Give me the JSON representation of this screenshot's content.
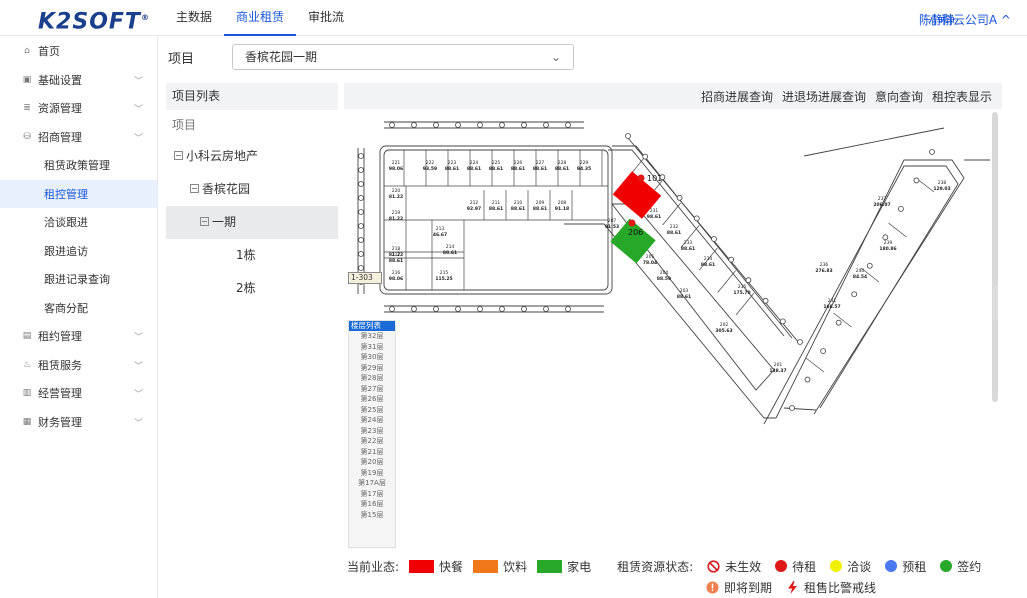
{
  "app": {
    "logo": "K2SOFT",
    "logo_mark": "®"
  },
  "topnav": [
    {
      "label": "主数据",
      "active": false
    },
    {
      "label": "商业租赁",
      "active": true
    },
    {
      "label": "审批流",
      "active": false
    }
  ],
  "header": {
    "user": "陈静静",
    "company": "小科云公司A ^"
  },
  "sidebar": {
    "items": [
      {
        "label": "首页",
        "icon": "home-icon",
        "glyph": "⌂",
        "expandable": false
      },
      {
        "label": "基础设置",
        "icon": "settings-icon",
        "glyph": "▣",
        "expandable": true
      },
      {
        "label": "资源管理",
        "icon": "resource-icon",
        "glyph": "≣",
        "expandable": true
      },
      {
        "label": "招商管理",
        "icon": "merchant-icon",
        "glyph": "⛁",
        "expandable": true
      }
    ],
    "subitems": [
      {
        "label": "租赁政策管理",
        "active": false
      },
      {
        "label": "租控管理",
        "active": true
      },
      {
        "label": "洽谈跟进",
        "active": false
      },
      {
        "label": "跟进追访",
        "active": false
      },
      {
        "label": "跟进记录查询",
        "active": false
      },
      {
        "label": "客商分配",
        "active": false
      }
    ],
    "items2": [
      {
        "label": "租约管理",
        "icon": "contract-icon",
        "glyph": "▤"
      },
      {
        "label": "租赁服务",
        "icon": "service-icon",
        "glyph": "♨"
      },
      {
        "label": "经营管理",
        "icon": "operation-icon",
        "glyph": "▥"
      },
      {
        "label": "财务管理",
        "icon": "finance-icon",
        "glyph": "▦"
      }
    ]
  },
  "project": {
    "label": "项目",
    "selected": "香槟花园一期"
  },
  "tree": {
    "title": "项目列表",
    "subtitle": "项目",
    "nodes": [
      {
        "label": "小科云房地产",
        "level": 0,
        "box": true,
        "selected": false
      },
      {
        "label": "香槟花园",
        "level": 1,
        "box": true,
        "selected": false
      },
      {
        "label": "一期",
        "level": 2,
        "box": true,
        "selected": true
      },
      {
        "label": "1栋",
        "level": 3,
        "box": false,
        "selected": false
      },
      {
        "label": "2栋",
        "level": 3,
        "box": false,
        "selected": false
      }
    ]
  },
  "toolbar": [
    "招商进展查询",
    "进退场进展查询",
    "意向查询",
    "租控表显示"
  ],
  "drawing": {
    "tag": "1-303",
    "red_marker": "101",
    "green_marker": "206",
    "units_left": [
      {
        "no": "221",
        "area": "98.06"
      },
      {
        "no": "222",
        "area": "93.59"
      },
      {
        "no": "223",
        "area": "88.61"
      },
      {
        "no": "224",
        "area": "88.61"
      },
      {
        "no": "225",
        "area": "88.61"
      },
      {
        "no": "226",
        "area": "88.61"
      },
      {
        "no": "227",
        "area": "88.61"
      },
      {
        "no": "228",
        "area": "88.61"
      },
      {
        "no": "229",
        "area": "94.35"
      },
      {
        "no": "220",
        "area": "81.22"
      },
      {
        "no": "219",
        "area": "81.22"
      },
      {
        "no": "212",
        "area": "92.97"
      },
      {
        "no": "211",
        "area": "88.61"
      },
      {
        "no": "210",
        "area": "88.61"
      },
      {
        "no": "209",
        "area": "88.61"
      },
      {
        "no": "208",
        "area": "91.18"
      },
      {
        "no": "218",
        "area": "81.22"
      },
      {
        "no": "213",
        "area": "46.67"
      },
      {
        "no": "217",
        "area": "88.61"
      },
      {
        "no": "214",
        "area": "88.61"
      },
      {
        "no": "216",
        "area": "98.06"
      },
      {
        "no": "215",
        "area": "115.25"
      }
    ],
    "units_mid": [
      {
        "no": "207",
        "area": "91.53"
      },
      {
        "no": "231",
        "area": "98.61"
      },
      {
        "no": "232",
        "area": "88.61"
      },
      {
        "no": "233",
        "area": "88.61"
      },
      {
        "no": "205",
        "area": "78.04"
      },
      {
        "no": "234",
        "area": "88.61"
      },
      {
        "no": "204",
        "area": "88.59"
      },
      {
        "no": "203",
        "area": "88.61"
      },
      {
        "no": "235",
        "area": "175.70"
      },
      {
        "no": "202",
        "area": "305.63"
      },
      {
        "no": "201",
        "area": "138.37"
      }
    ],
    "units_right": [
      {
        "no": "238",
        "area": "129.03"
      },
      {
        "no": "237",
        "area": "206.07"
      },
      {
        "no": "239",
        "area": "180.86"
      },
      {
        "no": "236",
        "area": "276.83"
      },
      {
        "no": "240",
        "area": "84.54"
      },
      {
        "no": "241",
        "area": "168.57"
      }
    ]
  },
  "floors": {
    "title": "楼层列表",
    "items": [
      "第32层",
      "第31层",
      "第30层",
      "第29层",
      "第28层",
      "第27层",
      "第26层",
      "第25层",
      "第24层",
      "第23层",
      "第22层",
      "第21层",
      "第20层",
      "第19层",
      "第17A层",
      "第17层",
      "第16层",
      "第15层"
    ]
  },
  "legend": {
    "business_label": "当前业态:",
    "business": [
      {
        "label": "快餐",
        "color": "#f00000"
      },
      {
        "label": "饮料",
        "color": "#f07818"
      },
      {
        "label": "家电",
        "color": "#28a828"
      }
    ],
    "status_label": "租赁资源状态:",
    "status": [
      {
        "label": "未生效",
        "icon": "invalid-icon",
        "color": "#d81e1e"
      },
      {
        "label": "待租",
        "icon": "dot-icon",
        "color": "#e01818"
      },
      {
        "label": "洽谈",
        "icon": "dot-icon",
        "color": "#f0f000"
      },
      {
        "label": "预租",
        "icon": "dot-icon",
        "color": "#4a78f0"
      },
      {
        "label": "签约",
        "icon": "dot-icon",
        "color": "#28a828"
      }
    ],
    "status2": [
      {
        "label": "即将到期",
        "icon": "alert-icon",
        "color": "#f08050"
      },
      {
        "label": "租售比警戒线",
        "icon": "lightning-icon",
        "color": "#e01818"
      }
    ]
  },
  "colors": {
    "accent": "#1a56db",
    "logo": "#1a3f8c",
    "red_unit": "#f00000",
    "green_unit": "#28a828"
  }
}
